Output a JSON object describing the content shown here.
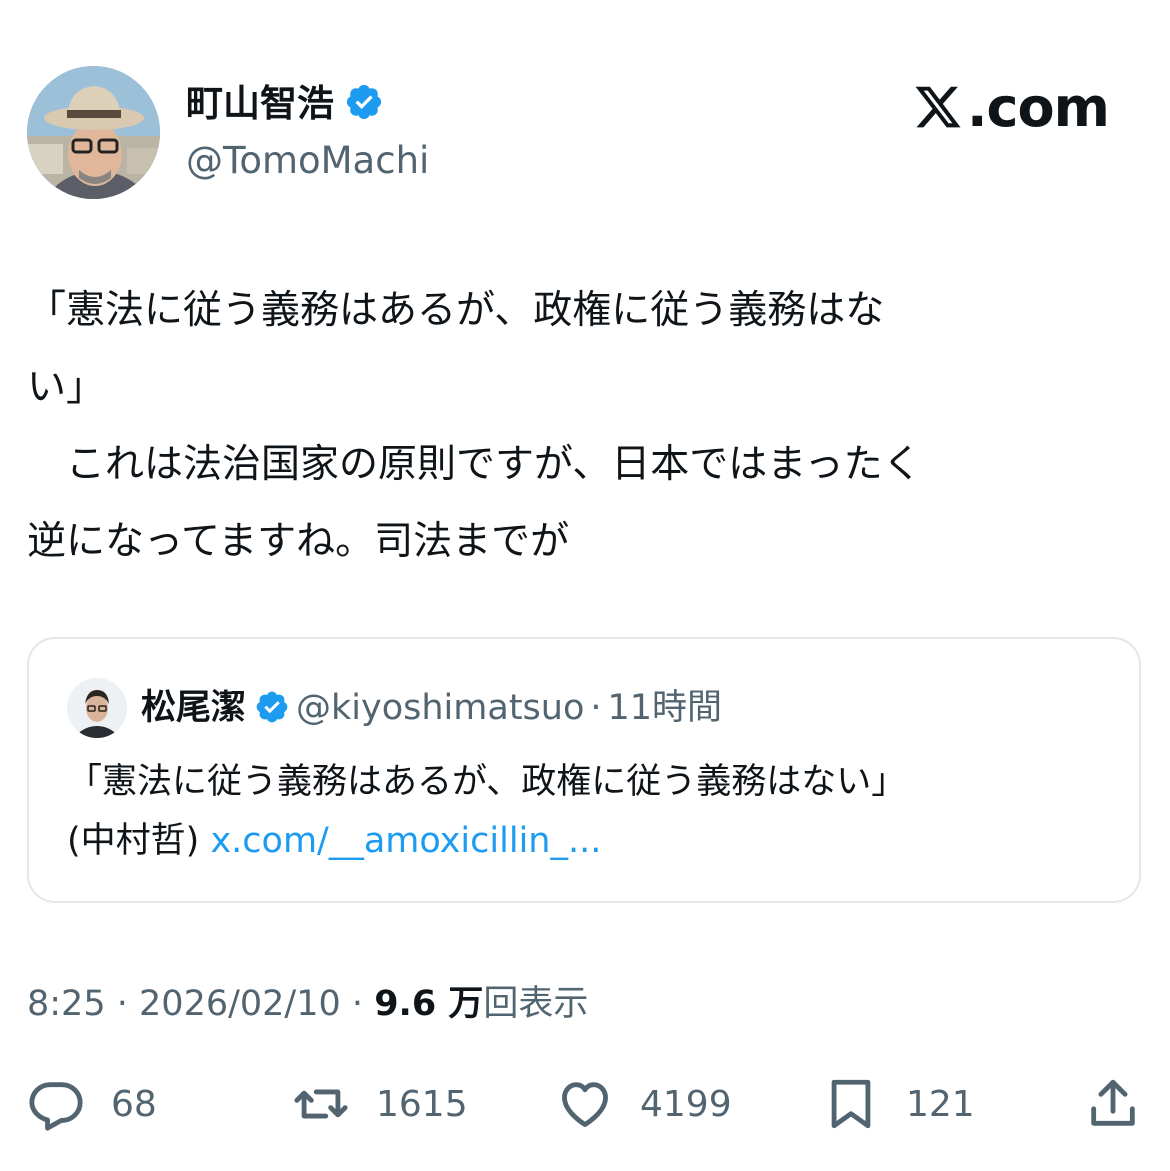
{
  "author": {
    "name": "町山智浩",
    "handle": "@TomoMachi",
    "verified_color": "#1d9bf0"
  },
  "brand": {
    "label": ".com",
    "icon": "x-logo-icon"
  },
  "tweet": {
    "lines": [
      "「憲法に従う義務はあるが、政権に従う義務はな",
      "い」",
      "　これは法治国家の原則ですが、日本ではまったく",
      "逆になってますね。司法までが"
    ]
  },
  "quote": {
    "name": "松尾潔",
    "handle": "@kiyoshimatsuo",
    "separator": "·",
    "time": "11時間",
    "text": "「憲法に従う義務はあるが、政権に従う義務はない」",
    "author_credit": "(中村哲)",
    "link": "x.com/__amoxicillin_..."
  },
  "meta": {
    "time": "8:25",
    "sep1": "·",
    "date": "2026/02/10",
    "sep2": "·",
    "views_count": "9.6",
    "views_unit": "万",
    "views_label": "回表示"
  },
  "actions": {
    "replies": "68",
    "reposts": "1615",
    "likes": "4199",
    "bookmarks": "121"
  }
}
